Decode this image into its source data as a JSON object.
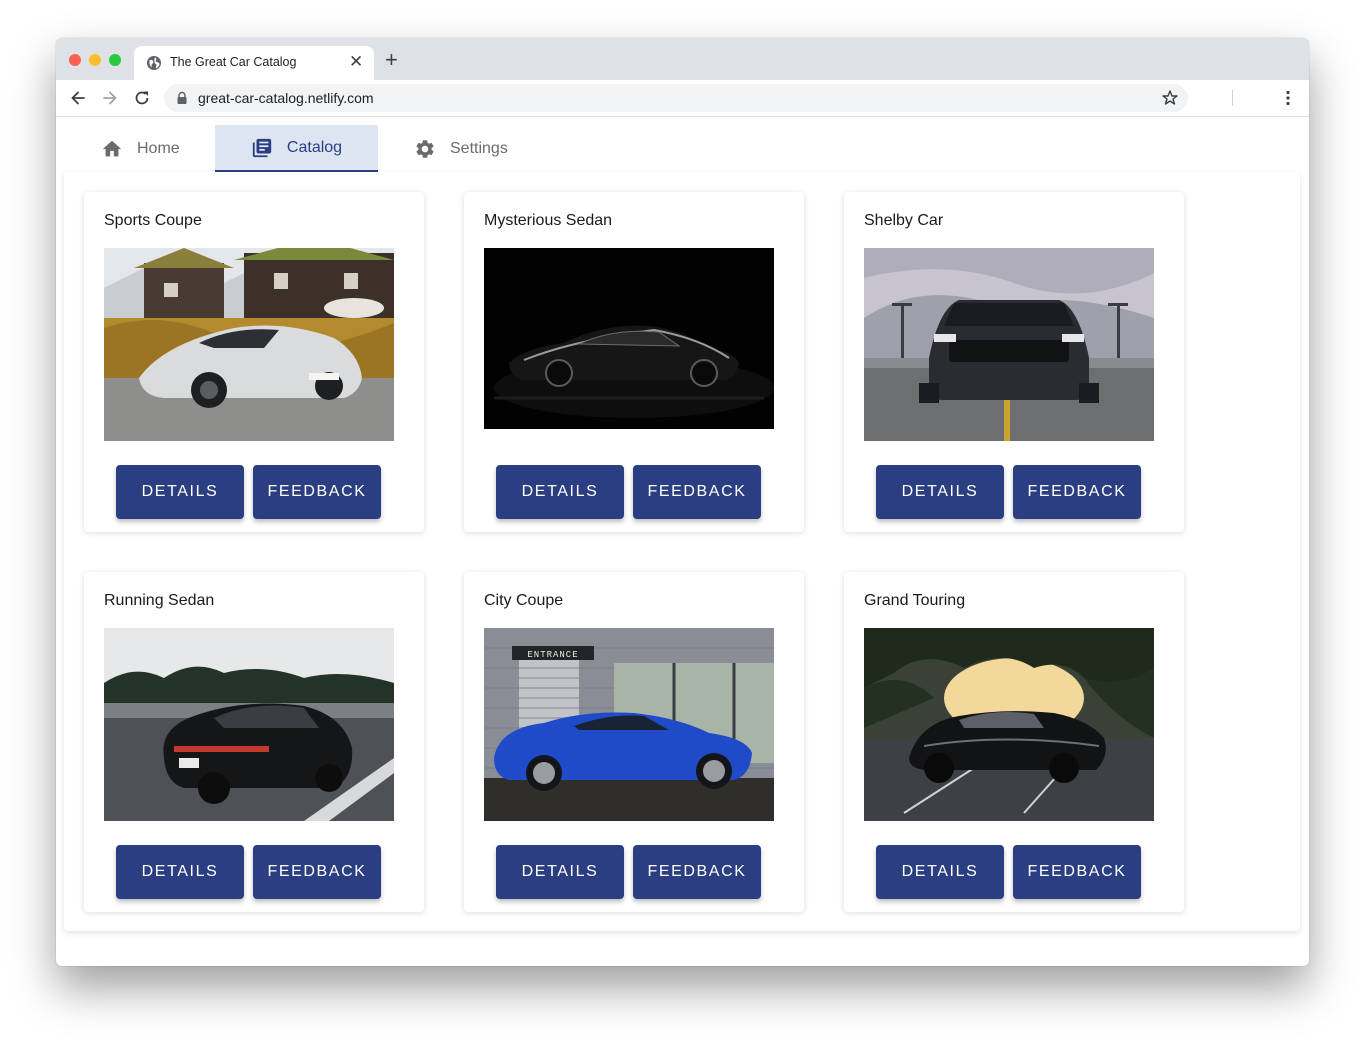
{
  "browser": {
    "tab_title": "The Great Car Catalog",
    "url": "great-car-catalog.netlify.com",
    "new_tab_symbol": "+",
    "close_symbol": "✕"
  },
  "nav": {
    "tabs": [
      {
        "label": "Home",
        "icon": "home-icon",
        "active": false
      },
      {
        "label": "Catalog",
        "icon": "library-books-icon",
        "active": true
      },
      {
        "label": "Settings",
        "icon": "gear-icon",
        "active": false
      }
    ]
  },
  "colors": {
    "primary": "#2c3e82",
    "active_tab_bg": "#dde4f2"
  },
  "cars": [
    {
      "title": "Sports Coupe",
      "details_label": "DETAILS",
      "feedback_label": "FEEDBACK",
      "image": "white-sports-car-near-wooden-houses"
    },
    {
      "title": "Mysterious Sedan",
      "details_label": "DETAILS",
      "feedback_label": "FEEDBACK",
      "image": "black-sedan-in-dark"
    },
    {
      "title": "Shelby Car",
      "details_label": "DETAILS",
      "feedback_label": "FEEDBACK",
      "image": "black-muscle-car-front-view-parking-lot"
    },
    {
      "title": "Running Sedan",
      "details_label": "DETAILS",
      "feedback_label": "FEEDBACK",
      "image": "black-sedan-driving-on-road"
    },
    {
      "title": "City Coupe",
      "details_label": "DETAILS",
      "feedback_label": "FEEDBACK",
      "image": "blue-coupe-in-front-of-entrance",
      "sign_text": "ENTRANCE"
    },
    {
      "title": "Grand Touring",
      "details_label": "DETAILS",
      "feedback_label": "FEEDBACK",
      "image": "black-muscle-car-under-trees-sunset"
    }
  ]
}
